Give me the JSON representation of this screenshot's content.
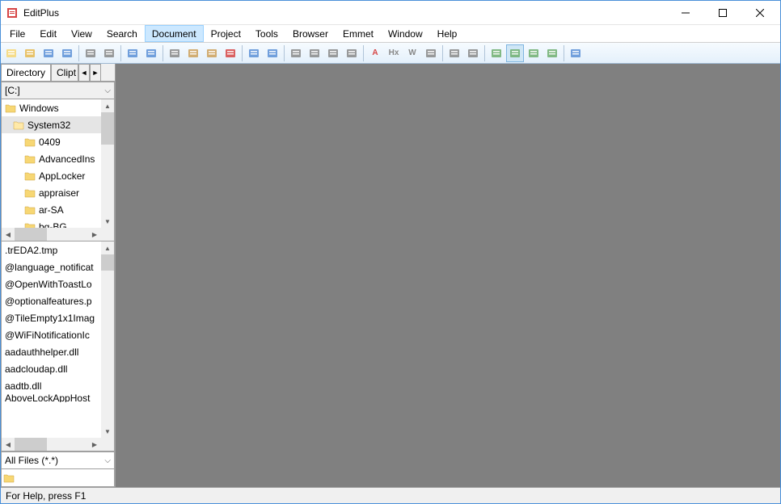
{
  "app": {
    "title": "EditPlus"
  },
  "menus": [
    "File",
    "Edit",
    "View",
    "Search",
    "Document",
    "Project",
    "Tools",
    "Browser",
    "Emmet",
    "Window",
    "Help"
  ],
  "menu_active_index": 4,
  "toolbar_icons": [
    {
      "n": "new-file-icon",
      "c": "#f7d774"
    },
    {
      "n": "open-icon",
      "c": "#e6b84f"
    },
    {
      "n": "save-icon",
      "c": "#5a8fd6"
    },
    {
      "n": "save-all-icon",
      "c": "#5a8fd6"
    },
    {
      "sep": true
    },
    {
      "n": "print-icon",
      "c": "#888"
    },
    {
      "n": "print-preview-icon",
      "c": "#888"
    },
    {
      "sep": true
    },
    {
      "n": "toggle-panel-icon",
      "c": "#5a8fd6"
    },
    {
      "n": "browser-icon",
      "c": "#5a8fd6"
    },
    {
      "sep": true
    },
    {
      "n": "cut-icon",
      "c": "#888"
    },
    {
      "n": "copy-icon",
      "c": "#cca05a"
    },
    {
      "n": "paste-icon",
      "c": "#cca05a"
    },
    {
      "n": "delete-icon",
      "c": "#d64545"
    },
    {
      "sep": true
    },
    {
      "n": "undo-icon",
      "c": "#5a8fd6"
    },
    {
      "n": "redo-icon",
      "c": "#5a8fd6"
    },
    {
      "sep": true
    },
    {
      "n": "find-icon",
      "c": "#888"
    },
    {
      "n": "replace-icon",
      "c": "#888"
    },
    {
      "n": "goto-icon",
      "c": "#888"
    },
    {
      "n": "bookmark-icon",
      "c": "#888"
    },
    {
      "sep": true
    },
    {
      "n": "font-icon",
      "c": "#d64545",
      "t": "A"
    },
    {
      "n": "hex-icon",
      "c": "#888",
      "t": "Hx"
    },
    {
      "n": "wrap-icon",
      "c": "#888",
      "t": "W"
    },
    {
      "n": "indent-icon",
      "c": "#888"
    },
    {
      "sep": true
    },
    {
      "n": "settings-icon",
      "c": "#888"
    },
    {
      "n": "gear-icon",
      "c": "#888"
    },
    {
      "sep": true
    },
    {
      "n": "view1-icon",
      "c": "#6fae6f",
      "sel": false
    },
    {
      "n": "view2-icon",
      "c": "#6fae6f",
      "sel": true
    },
    {
      "n": "view3-icon",
      "c": "#6fae6f"
    },
    {
      "n": "view4-icon",
      "c": "#6fae6f"
    },
    {
      "sep": true
    },
    {
      "n": "help-icon",
      "c": "#5a8fd6"
    }
  ],
  "sidebar": {
    "tabs": [
      "Directory",
      "Clipt"
    ],
    "active_tab": 0,
    "drive": "[C:]",
    "folders": [
      {
        "label": "Windows",
        "level": 0,
        "sel": false
      },
      {
        "label": "System32",
        "level": 1,
        "sel": true
      },
      {
        "label": "0409",
        "level": 2,
        "sel": false
      },
      {
        "label": "AdvancedIns",
        "level": 2,
        "sel": false
      },
      {
        "label": "AppLocker",
        "level": 2,
        "sel": false
      },
      {
        "label": "appraiser",
        "level": 2,
        "sel": false
      },
      {
        "label": "ar-SA",
        "level": 2,
        "sel": false
      },
      {
        "label": "bg-BG",
        "level": 2,
        "sel": false
      }
    ],
    "files": [
      ".trEDA2.tmp",
      "@language_notificat",
      "@OpenWithToastLo",
      "@optionalfeatures.p",
      "@TileEmpty1x1Imag",
      "@WiFiNotificationIc",
      "aadauthhelper.dll",
      "aadcloudap.dll",
      "aadtb.dll",
      "AboveLockAppHost"
    ],
    "filter": "All Files (*.*)"
  },
  "statusbar": {
    "text": "For Help, press F1"
  }
}
